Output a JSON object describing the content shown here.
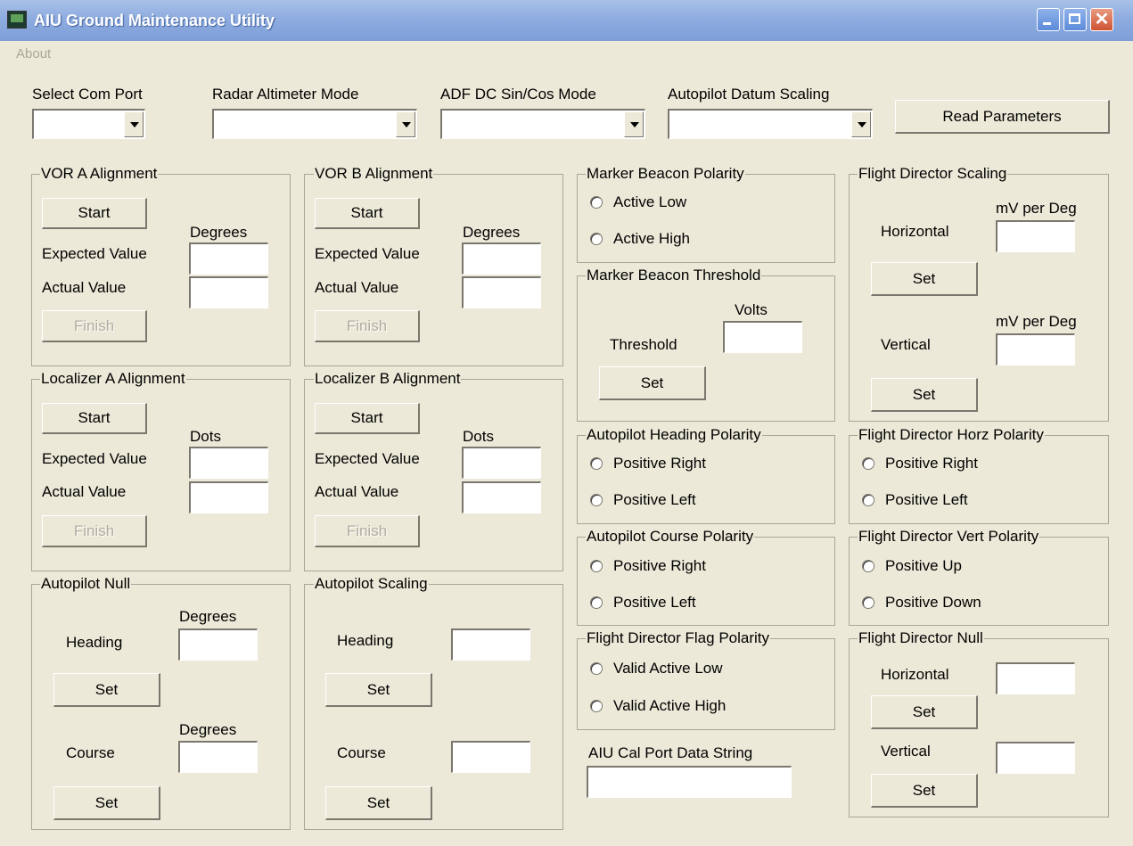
{
  "window": {
    "title": "AIU Ground Maintenance Utility"
  },
  "menu": {
    "about": "About"
  },
  "top": {
    "com_port": "Select Com Port",
    "radar_alt": "Radar Altimeter Mode",
    "adf": "ADF DC Sin/Cos Mode",
    "ap_datum": "Autopilot Datum Scaling",
    "read_params": "Read Parameters"
  },
  "vor_a": {
    "legend": "VOR A Alignment",
    "start": "Start",
    "units": "Degrees",
    "expected": "Expected Value",
    "actual": "Actual Value",
    "finish": "Finish"
  },
  "vor_b": {
    "legend": "VOR B Alignment",
    "start": "Start",
    "units": "Degrees",
    "expected": "Expected Value",
    "actual": "Actual Value",
    "finish": "Finish"
  },
  "loc_a": {
    "legend": "Localizer A Alignment",
    "start": "Start",
    "units": "Dots",
    "expected": "Expected Value",
    "actual": "Actual Value",
    "finish": "Finish"
  },
  "loc_b": {
    "legend": "Localizer B Alignment",
    "start": "Start",
    "units": "Dots",
    "expected": "Expected Value",
    "actual": "Actual Value",
    "finish": "Finish"
  },
  "ap_null": {
    "legend": "Autopilot Null",
    "heading_units": "Degrees",
    "heading": "Heading",
    "set": "Set",
    "course_units": "Degrees",
    "course": "Course"
  },
  "ap_scaling": {
    "legend": "Autopilot Scaling",
    "heading": "Heading",
    "set": "Set",
    "course": "Course"
  },
  "mb_polarity": {
    "legend": "Marker Beacon Polarity",
    "opt1": "Active Low",
    "opt2": "Active High"
  },
  "mb_threshold": {
    "legend": "Marker Beacon Threshold",
    "units": "Volts",
    "threshold": "Threshold",
    "set": "Set"
  },
  "ap_heading_pol": {
    "legend": "Autopilot Heading Polarity",
    "opt1": "Positive Right",
    "opt2": "Positive Left"
  },
  "ap_course_pol": {
    "legend": "Autopilot Course Polarity",
    "opt1": "Positive Right",
    "opt2": "Positive Left"
  },
  "fd_flag_pol": {
    "legend": "Flight Director Flag Polarity",
    "opt1": "Valid Active Low",
    "opt2": "Valid Active High"
  },
  "cal_port": {
    "label": "AIU Cal Port Data String"
  },
  "fd_scaling": {
    "legend": "Flight Director Scaling",
    "units_h": "mV per Deg",
    "horizontal": "Horizontal",
    "set": "Set",
    "units_v": "mV per Deg",
    "vertical": "Vertical"
  },
  "fd_horz_pol": {
    "legend": "Flight Director Horz Polarity",
    "opt1": "Positive Right",
    "opt2": "Positive Left"
  },
  "fd_vert_pol": {
    "legend": "Flight Director Vert Polarity",
    "opt1": "Positive Up",
    "opt2": "Positive Down"
  },
  "fd_null": {
    "legend": "Flight Director Null",
    "horizontal": "Horizontal",
    "set": "Set",
    "vertical": "Vertical"
  }
}
